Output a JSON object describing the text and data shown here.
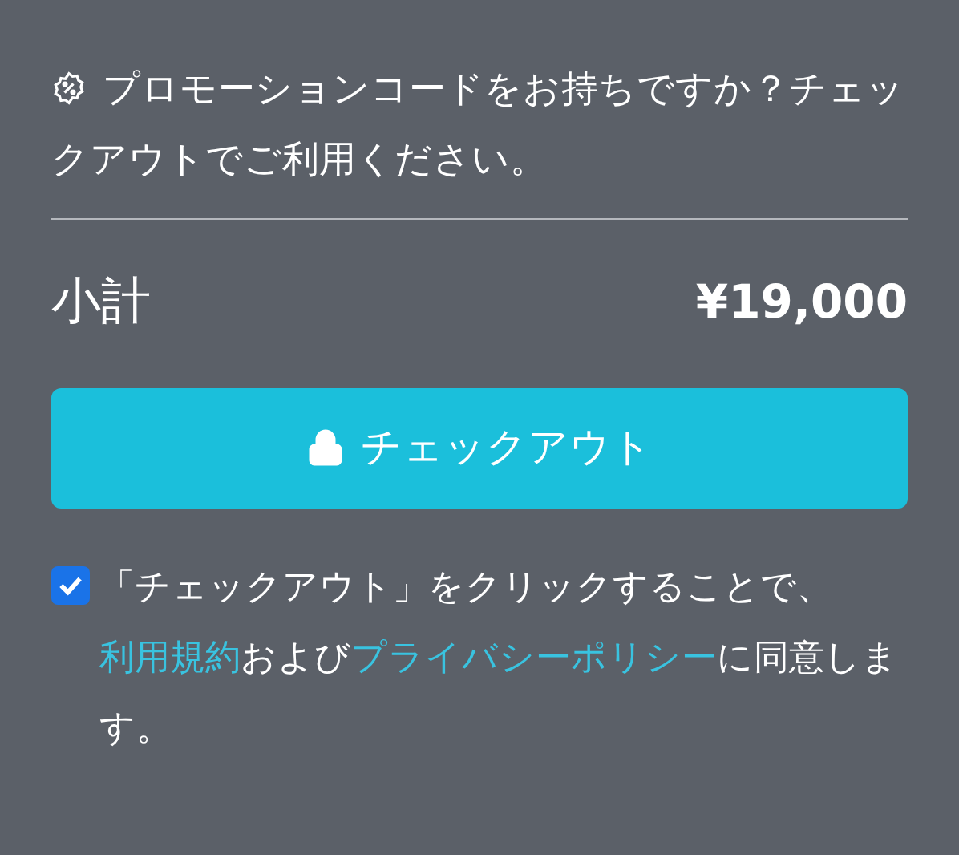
{
  "promo": {
    "text": "プロモーションコードをお持ちですか？チェックアウトでご利用ください。"
  },
  "subtotal": {
    "label": "小計",
    "value": "¥19,000"
  },
  "checkout_button": {
    "label": "チェックアウト"
  },
  "agreement": {
    "checked": true,
    "text_before": "「チェックアウト」をクリックすることで、",
    "terms_link": "利用規約",
    "text_middle": "および",
    "privacy_link": "プライバシーポリシー",
    "text_after": "に同意します。"
  }
}
